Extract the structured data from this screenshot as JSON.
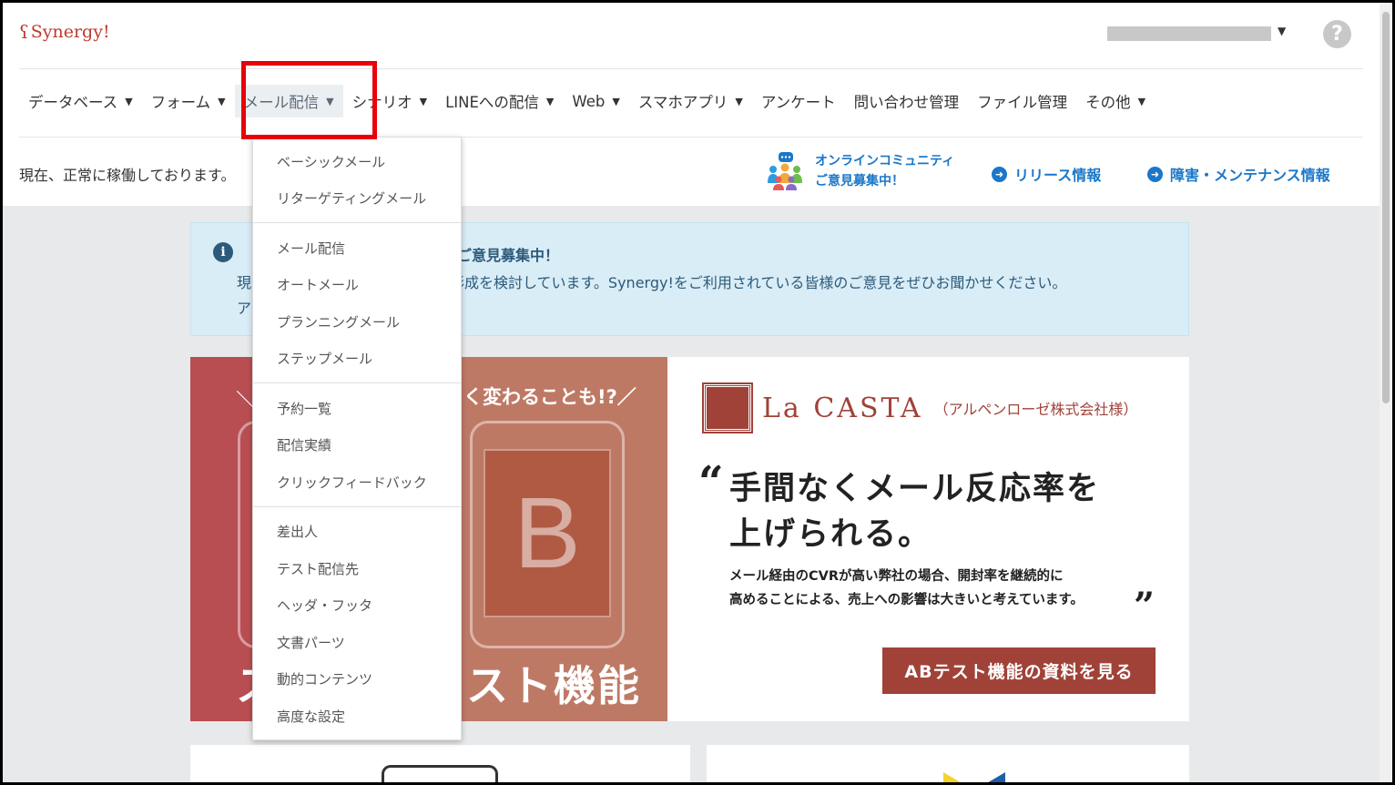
{
  "header": {
    "logo_text": "Synergy!",
    "help_symbol": "?"
  },
  "nav": {
    "items": [
      {
        "label": "データベース",
        "caret": true
      },
      {
        "label": "フォーム",
        "caret": true
      },
      {
        "label": "メール配信",
        "caret": true,
        "active": true
      },
      {
        "label": "シナリオ",
        "caret": true
      },
      {
        "label": "LINEへの配信",
        "caret": true
      },
      {
        "label": "Web",
        "caret": true
      },
      {
        "label": "スマホアプリ",
        "caret": true
      },
      {
        "label": "アンケート",
        "caret": false
      },
      {
        "label": "問い合わせ管理",
        "caret": false
      },
      {
        "label": "ファイル管理",
        "caret": false
      },
      {
        "label": "その他",
        "caret": true
      }
    ]
  },
  "status": {
    "text": "現在、正常に稼働しております。"
  },
  "links": {
    "community_line1": "オンラインコミュニティ",
    "community_line2": "ご意見募集中！",
    "release": "リリース情報",
    "maintenance": "障害・メンテナンス情報"
  },
  "notice": {
    "title_fragment": "するご意見募集中！",
    "line1_left": "現",
    "line1_right": "形成を検討しています。Synergy!をご利用されている皆様のご意見をぜひお聞かせください。",
    "line2_left": "ア"
  },
  "banner": {
    "left_top_text": "く変わることも!?／",
    "left_slash": "＼",
    "left_bottom_text": "スト機能",
    "left_bottom_prefix": "ス",
    "phone_letter": "B",
    "brand_name": "La CASTA",
    "brand_company": "（アルペンローゼ株式会社様）",
    "quote_open": "“",
    "headline_line1": "手間なくメール反応率を",
    "headline_line2": "上げられる。",
    "sub_line1": "メール経由のCVRが高い弊社の場合、開封率を継続的に",
    "sub_line2": "高めることによる、売上への影響は大きいと考えています。",
    "quote_close": "”",
    "cta_label": "ABテスト機能の資料を見る"
  },
  "dropdown": {
    "groups": [
      [
        "ベーシックメール",
        "リターゲティングメール"
      ],
      [
        "メール配信",
        "オートメール",
        "プランニングメール",
        "ステップメール"
      ],
      [
        "予約一覧",
        "配信実績",
        "クリックフィードバック"
      ],
      [
        "差出人",
        "テスト配信先",
        "ヘッダ・フッタ",
        "文書パーツ",
        "動的コンテンツ",
        "高度な設定"
      ]
    ]
  },
  "colors": {
    "accent_blue": "#1a77c9",
    "highlight_red": "#e8000b",
    "brand_red": "#a04238"
  }
}
